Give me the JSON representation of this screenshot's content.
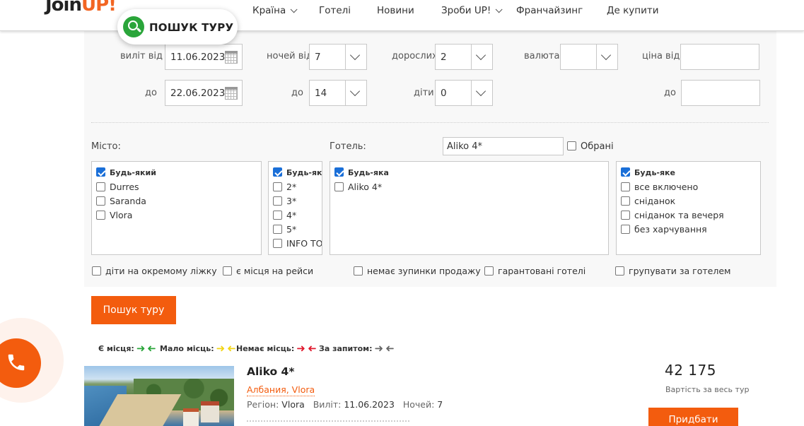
{
  "brand": {
    "logo_main": "Join",
    "logo_accent": "UP!"
  },
  "nav": {
    "items": [
      {
        "label": "Країна",
        "has_dropdown": true
      },
      {
        "label": "Готелі",
        "has_dropdown": false
      },
      {
        "label": "Новини",
        "has_dropdown": false
      },
      {
        "label": "Зроби UP!",
        "has_dropdown": true
      },
      {
        "label": "Франчайзинг",
        "has_dropdown": false
      },
      {
        "label": "Де купити",
        "has_dropdown": false
      }
    ],
    "search_pill_label": "ПОШУК ТУРУ"
  },
  "form": {
    "depart_from_label": "виліт від",
    "depart_from_value": "11.06.2023",
    "depart_to_label": "до",
    "depart_to_value": "22.06.2023",
    "nights_from_label": "ночей від",
    "nights_from_value": "7",
    "nights_to_label": "до",
    "nights_to_value": "14",
    "adults_label": "дорослих",
    "adults_value": "2",
    "children_label": "діти",
    "children_value": "0",
    "currency_label": "валюта",
    "currency_value": "",
    "price_from_label": "ціна від",
    "price_from_value": "",
    "price_to_label": "до",
    "price_to_value": "",
    "city_label": "Місто:",
    "hotel_label": "Готель:",
    "hotel_value": "Aliko 4*",
    "favorites_label": "Обрані",
    "cities": [
      {
        "label": "Будь-який",
        "checked": true
      },
      {
        "label": "Durres",
        "checked": false
      },
      {
        "label": "Saranda",
        "checked": false
      },
      {
        "label": "Vlora",
        "checked": false
      }
    ],
    "stars": [
      {
        "label": "Будь-яка",
        "checked": true
      },
      {
        "label": "2*",
        "checked": false
      },
      {
        "label": "3*",
        "checked": false
      },
      {
        "label": "4*",
        "checked": false
      },
      {
        "label": "5*",
        "checked": false
      },
      {
        "label": "INFO TOUR",
        "checked": false
      }
    ],
    "hotels": [
      {
        "label": "Будь-яка",
        "checked": true
      },
      {
        "label": "Aliko 4*",
        "checked": false
      }
    ],
    "meals": [
      {
        "label": "Будь-яке",
        "checked": true
      },
      {
        "label": "все включено",
        "checked": false
      },
      {
        "label": "сніданок",
        "checked": false
      },
      {
        "label": "сніданок та вечеря",
        "checked": false
      },
      {
        "label": "без харчування",
        "checked": false
      }
    ],
    "options": [
      {
        "label": "діти на окремому ліжку",
        "checked": false
      },
      {
        "label": "є місця на рейси",
        "checked": false
      },
      {
        "label": "немає зупинки продажу",
        "checked": false
      },
      {
        "label": "гарантовані готелі",
        "checked": false
      },
      {
        "label": "групувати за готелем",
        "checked": false
      }
    ],
    "submit_label": "Пошук туру"
  },
  "legend": {
    "available": "Є місця:",
    "few": "Мало місць:",
    "none": "Немає місць:",
    "request": "За запитом:",
    "colors": {
      "available": "#2aa53a",
      "few": "#f2d516",
      "none": "#e0192d",
      "request": "#666666"
    }
  },
  "result": {
    "hotel_name": "Aliko 4*",
    "location": "Албания, Vlora",
    "region_label": "Регіон:",
    "region_value": "Vlora",
    "depart_label": "Виліт:",
    "depart_value": "11.06.2023",
    "nights_label": "Ночей:",
    "nights_value": "7",
    "price": "42 175",
    "price_note": "Вартість за весь тур",
    "buy_label": "Придбати"
  },
  "colors": {
    "accent": "#f35c0e",
    "search_icon": "#2aa53a",
    "checkbox": "#1a6fd8"
  }
}
